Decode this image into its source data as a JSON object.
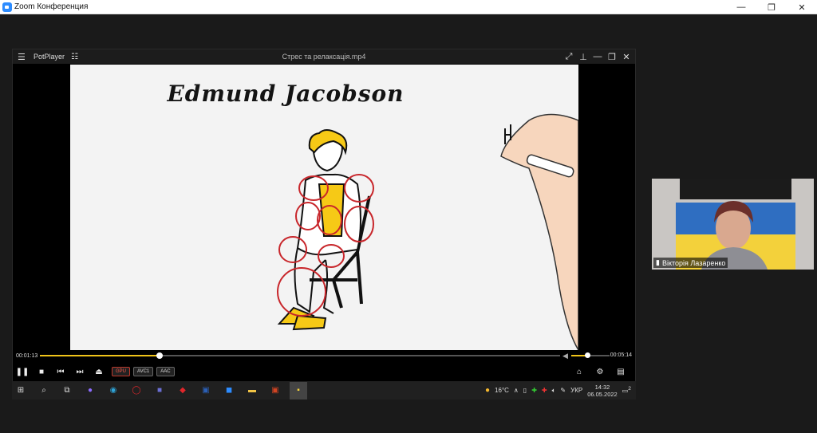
{
  "window": {
    "title": "Zoom Конференция",
    "controls": [
      "—",
      "❐",
      "✕"
    ]
  },
  "player": {
    "brand": "PotPlayer",
    "file": "Стрес та релаксація.mp4",
    "video_title": "Edmund Jacobson",
    "elapsed": "00:01:13",
    "total": "00:05:14",
    "progress_fraction": 0.23,
    "volume_fraction": 0.42,
    "badges": [
      "GPU",
      "AVC1",
      "AAC"
    ]
  },
  "taskbar": {
    "weather": "16°C",
    "lang": "УКР",
    "time": "14:32",
    "date": "06.05.2022",
    "notifications": "2"
  },
  "participant": {
    "name": "Вікторія Лазаренко"
  },
  "colors": {
    "accent": "#f0c419",
    "zoom_blue": "#2d8cff"
  }
}
